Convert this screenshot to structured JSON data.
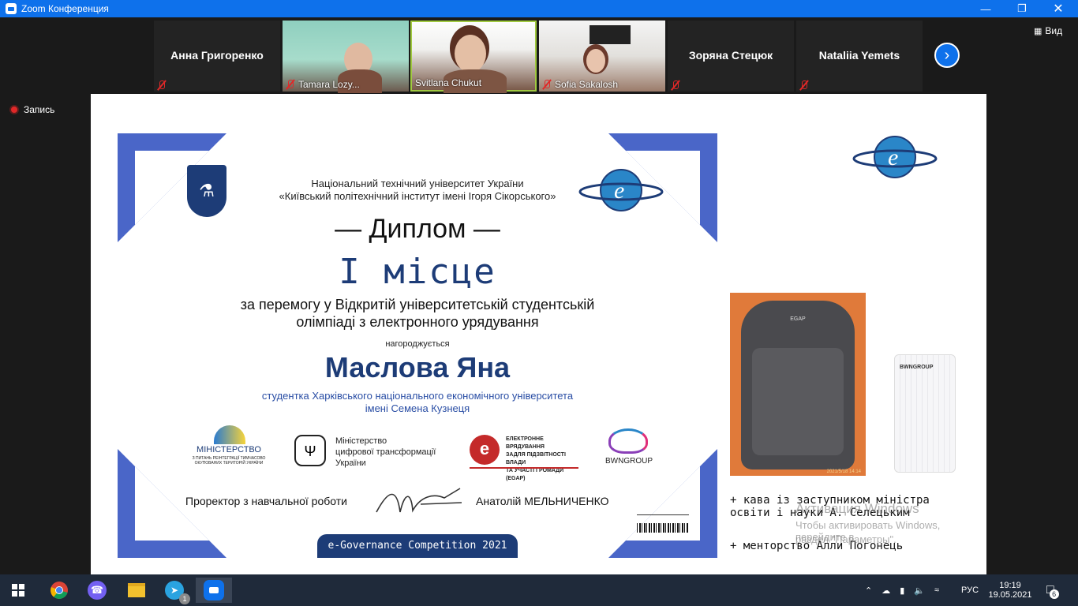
{
  "window": {
    "title": "Zoom Конференция",
    "minimize_icon": "minimize-icon",
    "restore_icon": "restore-icon",
    "close_icon": "close-icon"
  },
  "participants": [
    {
      "name": "Анна Григоренко",
      "video": false
    },
    {
      "name": "Tamara Lozy...",
      "video": true
    },
    {
      "name": "Svitlana Chukut",
      "video": true,
      "active_speaker": true
    },
    {
      "name": "Sofia Sakalosh",
      "video": true
    },
    {
      "name": "Зоряна Стецюк",
      "video": false
    },
    {
      "name": "Nataliia Yemets",
      "video": false
    }
  ],
  "view_label": "Вид",
  "recording_label": "Запись",
  "diploma": {
    "university_line1": "Національний технічний університет України",
    "university_line2": "«Київський політехнічний інститут імені Ігоря Сікорського»",
    "title": "Диплом",
    "place": "I місце",
    "for_line1": "за перемогу у Відкритій університетській студентській",
    "for_line2": "олімпіаді з електронного урядування",
    "awarded": "нагороджується",
    "winner": "Маслова Яна",
    "student_line1": "студентка Харківського національного економічного університета",
    "student_line2": "імені Семена Кузнеця",
    "logos": {
      "ministry_title": "МІНІСТЕРСТВО",
      "ministry_sub": "З ПИТАНЬ РЕІНТЕГРАЦІЇ ТИМЧАСОВО ОКУПОВАНИХ ТЕРИТОРІЙ УКРАЇНИ",
      "digital_line1": "Міністерство",
      "digital_line2": "цифрової трансформації",
      "digital_line3": "України",
      "egap_line1": "ЕЛЕКТРОННЕ ВРЯДУВАННЯ",
      "egap_line2": "ЗАДЛЯ ПІДЗВІТНОСТІ ВЛАДИ",
      "egap_line3": "ТА УЧАСТІ ГРОМАДИ (EGAP)",
      "bwn": "BWNGROUP"
    },
    "prorector": "Проректор з навчальної роботи",
    "signer": "Анатолій МЕЛЬНИЧЕНКО",
    "footer": "e-Governance Competition 2021"
  },
  "prizes": {
    "item1_line1": "+ кава із заступником міністра",
    "item1_line2": "освіти і науки А. Селецьким",
    "item2": "+ менторство Алли Погонець",
    "backpack_brand": "EGAP",
    "backpack_stamp": "2021/5/18 14:14",
    "box_brand": "BWNGROUP"
  },
  "watermark": {
    "line1": "Активация Windows",
    "line2": "Чтобы активировать Windows, перейдите в",
    "line3": "раздел \"Параметры\"."
  },
  "taskbar": {
    "apps": [
      "start-icon",
      "chrome-icon",
      "viber-icon",
      "file-explorer-icon",
      "telegram-icon",
      "zoom-icon"
    ],
    "telegram_badge": "1",
    "lang": "РУС",
    "time": "19:19",
    "date": "19.05.2021",
    "notif_count": "6"
  },
  "colors": {
    "zoom_blue": "#0e71eb",
    "diploma_blue": "#4a66c8",
    "navy": "#1d3c77",
    "active_border": "#a0c940",
    "mute_red": "#e02828"
  }
}
